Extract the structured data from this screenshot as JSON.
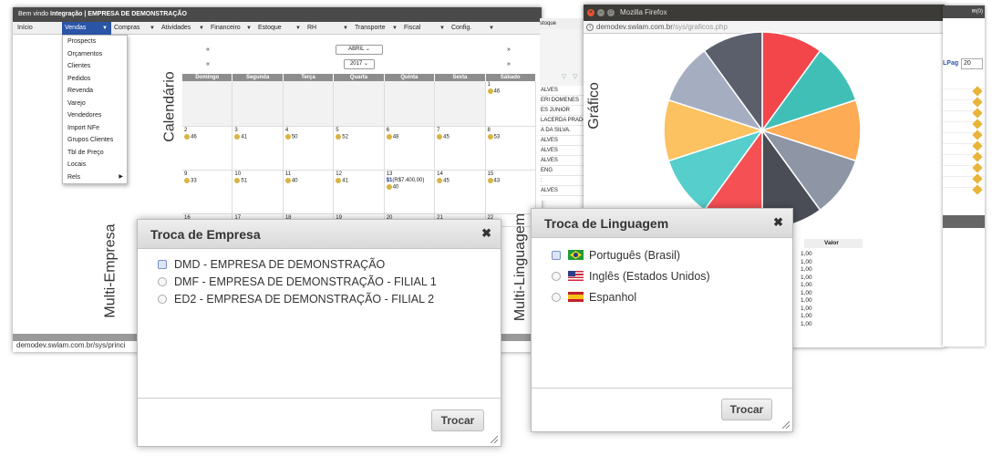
{
  "app": {
    "title_prefix": "Bem vindo ",
    "title_user": "Integração",
    "title_company": " | EMPRESA DE DEMONSTRAÇÃO",
    "menu": [
      {
        "label": "Início"
      },
      {
        "label": "Vendas"
      },
      {
        "label": "Compras"
      },
      {
        "label": "Atividades"
      },
      {
        "label": "Financeiro"
      },
      {
        "label": "Estoque"
      },
      {
        "label": "RH"
      },
      {
        "label": "Transporte"
      },
      {
        "label": "Fiscal"
      },
      {
        "label": "Config."
      }
    ],
    "vendas_menu": [
      "Prospects",
      "Orçamentos",
      "Clientes",
      "Pedidos",
      "Revenda",
      "Varejo",
      "Vendedores",
      "Import NFe",
      "Grupos Clientes",
      "Tbl de Preço",
      "Locais",
      "Rels"
    ],
    "status_url": "demodev.swlam.com.br/sys/princi"
  },
  "labels": {
    "calendario": "Calendário",
    "multi_empresa": "Multi-Empresa",
    "multi_linguagem": "Multi-Linguagem",
    "grafico": "Gráfico"
  },
  "calendar": {
    "prev": "«",
    "next": "»",
    "month": "ABRIL",
    "year": "2017",
    "weekdays": [
      "Domingo",
      "Segunda",
      "Terça",
      "Quarta",
      "Quinta",
      "Sexta",
      "Sábado"
    ],
    "weeks": [
      [
        {
          "day": "",
          "count": ""
        },
        {
          "day": "",
          "count": ""
        },
        {
          "day": "",
          "count": ""
        },
        {
          "day": "",
          "count": ""
        },
        {
          "day": "",
          "count": ""
        },
        {
          "day": "",
          "count": ""
        },
        {
          "day": "1",
          "count": "46"
        }
      ],
      [
        {
          "day": "2",
          "count": "46"
        },
        {
          "day": "3",
          "count": "41"
        },
        {
          "day": "4",
          "count": "50"
        },
        {
          "day": "5",
          "count": "52"
        },
        {
          "day": "6",
          "count": "48"
        },
        {
          "day": "7",
          "count": "45"
        },
        {
          "day": "8",
          "count": "53"
        }
      ],
      [
        {
          "day": "9",
          "count": "33"
        },
        {
          "day": "10",
          "count": "51"
        },
        {
          "day": "11",
          "count": "40"
        },
        {
          "day": "12",
          "count": "41"
        },
        {
          "day": "13",
          "count": "40",
          "money_count": "1",
          "money": "(R$7.400,00)"
        },
        {
          "day": "14",
          "count": "45"
        },
        {
          "day": "15",
          "count": "43"
        }
      ],
      [
        {
          "day": "16"
        },
        {
          "day": "17"
        },
        {
          "day": "18"
        },
        {
          "day": "19"
        },
        {
          "day": "20"
        },
        {
          "day": "21"
        },
        {
          "day": "22"
        }
      ]
    ]
  },
  "mid_panel": {
    "rows": [
      "ALVES",
      "ERI DOMENES",
      "ES JUNIOR",
      "LACERDA PRADO",
      "A DA SILVA.",
      "ALVES",
      "ALVES",
      "ALVES",
      "ENG",
      ":",
      "ALVES"
    ],
    "field": "stoque"
  },
  "firefox": {
    "window_title": "Mozilla Firefox",
    "url_host": "demodev.swlam.com.br",
    "url_path": "/sys/graficos.php"
  },
  "right_app": {
    "counter": "(0)",
    "lpag_label": "LPag",
    "lpag_value": "20",
    "valor_header": "Valor",
    "values": [
      "1,00",
      "1,00",
      "1,00",
      "1,00",
      "1,00",
      "1,00",
      "1,00",
      "1,00",
      "1,00",
      "1,00"
    ]
  },
  "dialog_empresa": {
    "title": "Troca de Empresa",
    "close": "✖",
    "options": [
      "DMD - EMPRESA DE DEMONSTRAÇÃO",
      "DMF - EMPRESA DE DEMONSTRAÇÃO - FILIAL 1",
      "ED2 - EMPRESA DE DEMONSTRAÇÃO - FILIAL 2"
    ],
    "selected": 0,
    "button": "Trocar"
  },
  "dialog_linguagem": {
    "title": "Troca de Linguagem",
    "close": "✖",
    "options": [
      {
        "label": "Português (Brasil)",
        "flag": "brazil-flag-icon"
      },
      {
        "label": "Inglês (Estados Unidos)",
        "flag": "usa-flag-icon"
      },
      {
        "label": "Espanhol",
        "flag": "spain-flag-icon"
      }
    ],
    "selected": 0,
    "button": "Trocar"
  },
  "pie_colors": [
    "#f2464b",
    "#40bfb7",
    "#fdab55",
    "#8e96a6",
    "#4a4c56",
    "#f55054",
    "#56cecb",
    "#fcc160",
    "#a5aec0",
    "#5b5f6b"
  ],
  "icons": {
    "close": "close-icon",
    "edit": "edit-icon",
    "info": "info-icon",
    "resize": "resize-grip-icon"
  }
}
